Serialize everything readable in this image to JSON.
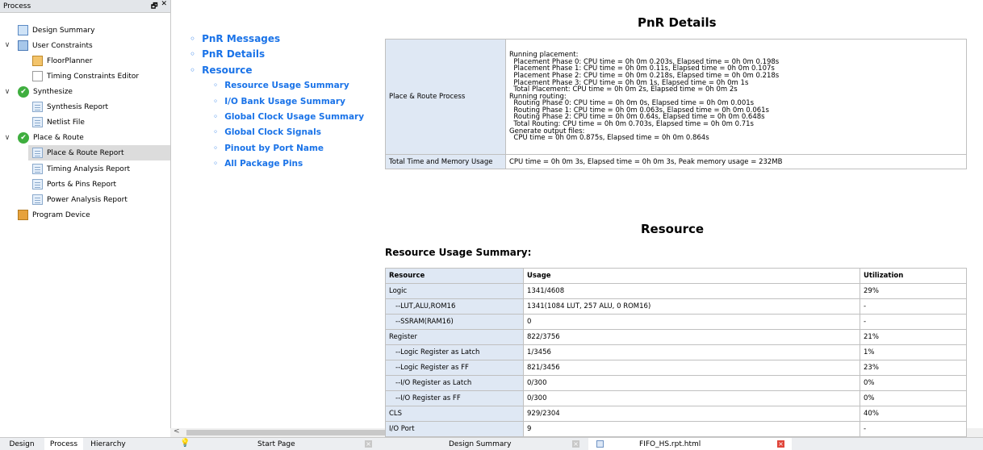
{
  "process_panel": {
    "title": "Process",
    "float_btn": "🗗",
    "close_btn": "✕",
    "items": [
      {
        "label": "Design Summary"
      },
      {
        "label": "User Constraints"
      },
      {
        "label": "FloorPlanner"
      },
      {
        "label": "Timing Constraints Editor"
      },
      {
        "label": "Synthesize"
      },
      {
        "label": "Synthesis Report"
      },
      {
        "label": "Netlist File"
      },
      {
        "label": "Place & Route"
      },
      {
        "label": "Place & Route Report"
      },
      {
        "label": "Timing Analysis Report"
      },
      {
        "label": "Ports & Pins Report"
      },
      {
        "label": "Power Analysis Report"
      },
      {
        "label": "Program Device"
      }
    ],
    "bottom_tabs": [
      "Design",
      "Process",
      "Hierarchy"
    ]
  },
  "doc_tabs": [
    {
      "label": "Start Page"
    },
    {
      "label": "Design Summary"
    },
    {
      "label": "FIFO_HS.rpt.html"
    }
  ],
  "toc": {
    "bullet": "◦",
    "top": [
      "PnR Messages",
      "PnR Details",
      "Resource"
    ],
    "sub": [
      "Resource Usage Summary",
      "I/O Bank Usage Summary",
      "Global Clock Usage Summary",
      "Global Clock Signals",
      "Pinout by Port Name",
      "All Package Pins"
    ]
  },
  "pnr_details": {
    "title": "PnR Details",
    "row1_label": "Place & Route Process",
    "row1_lines": [
      "Running placement:",
      "  Placement Phase 0: CPU time = 0h 0m 0.203s, Elapsed time = 0h 0m 0.198s",
      "  Placement Phase 1: CPU time = 0h 0m 0.11s, Elapsed time = 0h 0m 0.107s",
      "  Placement Phase 2: CPU time = 0h 0m 0.218s, Elapsed time = 0h 0m 0.218s",
      "  Placement Phase 3: CPU time = 0h 0m 1s, Elapsed time = 0h 0m 1s",
      "  Total Placement: CPU time = 0h 0m 2s, Elapsed time = 0h 0m 2s",
      "Running routing:",
      "  Routing Phase 0: CPU time = 0h 0m 0s, Elapsed time = 0h 0m 0.001s",
      "  Routing Phase 1: CPU time = 0h 0m 0.063s, Elapsed time = 0h 0m 0.061s",
      "  Routing Phase 2: CPU time = 0h 0m 0.64s, Elapsed time = 0h 0m 0.648s",
      "  Total Routing: CPU time = 0h 0m 0.703s, Elapsed time = 0h 0m 0.71s",
      "Generate output files:",
      "  CPU time = 0h 0m 0.875s, Elapsed time = 0h 0m 0.864s"
    ],
    "row2_label": "Total Time and Memory Usage",
    "row2_value": "CPU time = 0h 0m 3s, Elapsed time = 0h 0m 3s, Peak memory usage = 232MB"
  },
  "resource": {
    "title": "Resource",
    "subtitle": "Resource Usage Summary:",
    "headers": [
      "Resource",
      "Usage",
      "Utilization"
    ],
    "rows": [
      [
        "Logic",
        "1341/4608",
        "29%"
      ],
      [
        "--LUT,ALU,ROM16",
        "1341(1084 LUT, 257 ALU, 0 ROM16)",
        "-"
      ],
      [
        "--SSRAM(RAM16)",
        "0",
        "-"
      ],
      [
        "Register",
        "822/3756",
        "21%"
      ],
      [
        "--Logic Register as Latch",
        "1/3456",
        "1%"
      ],
      [
        "--Logic Register as FF",
        "821/3456",
        "23%"
      ],
      [
        "--I/O Register as Latch",
        "0/300",
        "0%"
      ],
      [
        "--I/O Register as FF",
        "0/300",
        "0%"
      ],
      [
        "CLS",
        "929/2304",
        "40%"
      ],
      [
        "I/O Port",
        "9",
        "-"
      ]
    ]
  }
}
